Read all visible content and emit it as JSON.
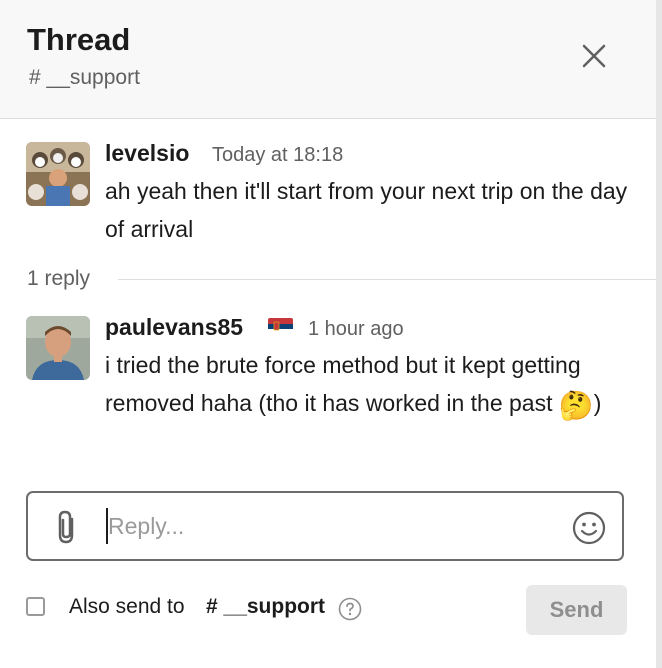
{
  "header": {
    "title": "Thread",
    "channel": "# __support"
  },
  "messages": [
    {
      "author": "levelsio",
      "timestamp": "Today at 18:18",
      "text": "ah yeah then it'll start from your next trip on the day of arrival"
    },
    {
      "author": "paulevans85",
      "timestamp": "1 hour ago",
      "text": "i tried the brute force method but it kept getting removed haha (tho it has worked in the past ",
      "emoji": "🤔",
      "text_after": ")"
    }
  ],
  "thread": {
    "reply_count": "1 reply"
  },
  "composer": {
    "placeholder": "Reply...",
    "value": ""
  },
  "also_send": {
    "label": "Also send to",
    "channel": "# __support",
    "checked": false
  },
  "send_label": "Send",
  "icons": {
    "close": "close-icon",
    "attach": "paperclip-icon",
    "emoji": "smiley-icon",
    "help": "question-icon",
    "flag": "serbia-flag-icon"
  }
}
